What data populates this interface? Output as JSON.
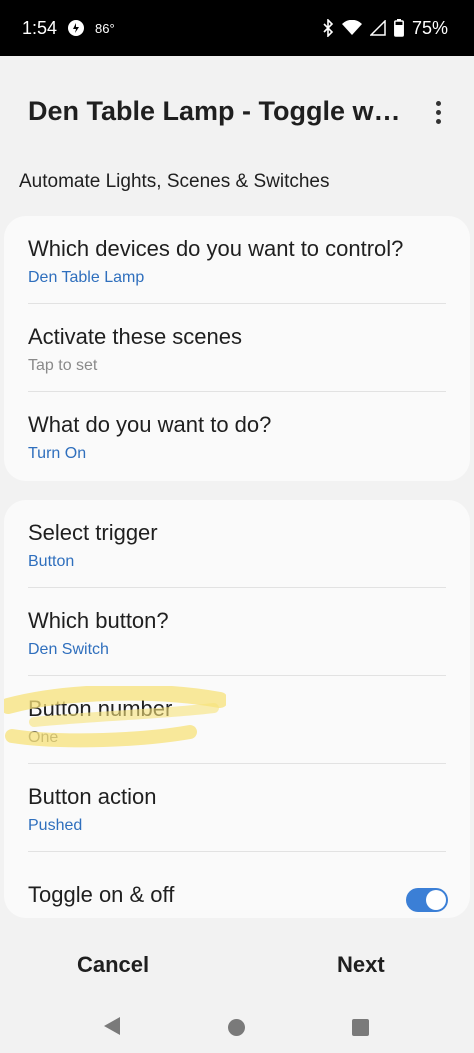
{
  "status_bar": {
    "time": "1:54",
    "temperature": "86°",
    "battery": "75%"
  },
  "app_bar": {
    "title": "Den Table Lamp - Toggle w…"
  },
  "subtitle": "Automate Lights, Scenes & Switches",
  "card1": {
    "rows": [
      {
        "label": "Which devices do you want to control?",
        "value": "Den Table Lamp"
      },
      {
        "label": "Activate these scenes",
        "value": "Tap to set"
      },
      {
        "label": "What do you want to do?",
        "value": "Turn On"
      }
    ]
  },
  "card2": {
    "rows": [
      {
        "label": "Select trigger",
        "value": "Button"
      },
      {
        "label": "Which button?",
        "value": "Den Switch"
      },
      {
        "label": "Button number",
        "value": "One"
      },
      {
        "label": "Button action",
        "value": "Pushed"
      }
    ],
    "toggle": {
      "label": "Toggle on & off",
      "on": true
    }
  },
  "actions": {
    "cancel": "Cancel",
    "next": "Next"
  },
  "colors": {
    "accent": "#2f6fbd",
    "toggle_on": "#3b7fd6",
    "highlight": "#f7e27a"
  }
}
